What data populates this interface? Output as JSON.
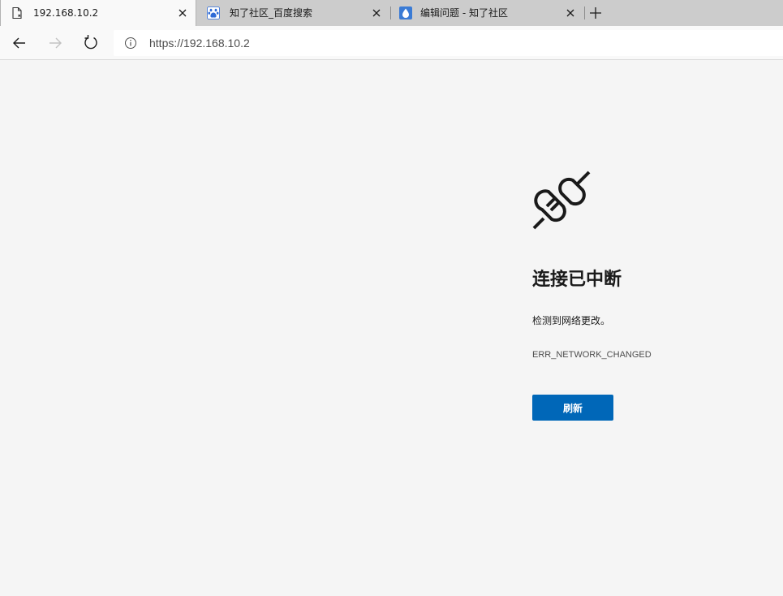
{
  "tabs": [
    {
      "title": "192.168.10.2",
      "icon": "page-error-icon",
      "active": true
    },
    {
      "title": "知了社区_百度搜索",
      "icon": "baidu-paw-icon",
      "active": false
    },
    {
      "title": "编辑问题 - 知了社区",
      "icon": "zhiliao-drop-icon",
      "active": false
    }
  ],
  "address": {
    "url": "https://192.168.10.2",
    "icon": "info-icon"
  },
  "error": {
    "icon": "unplugged-icon",
    "heading": "连接已中断",
    "description": "检测到网络更改。",
    "code": "ERR_NETWORK_CHANGED",
    "button_label": "刷新"
  },
  "colors": {
    "accent": "#0067b8",
    "page_bg": "#f5f5f5",
    "tabstrip_bg": "#cccccc"
  }
}
